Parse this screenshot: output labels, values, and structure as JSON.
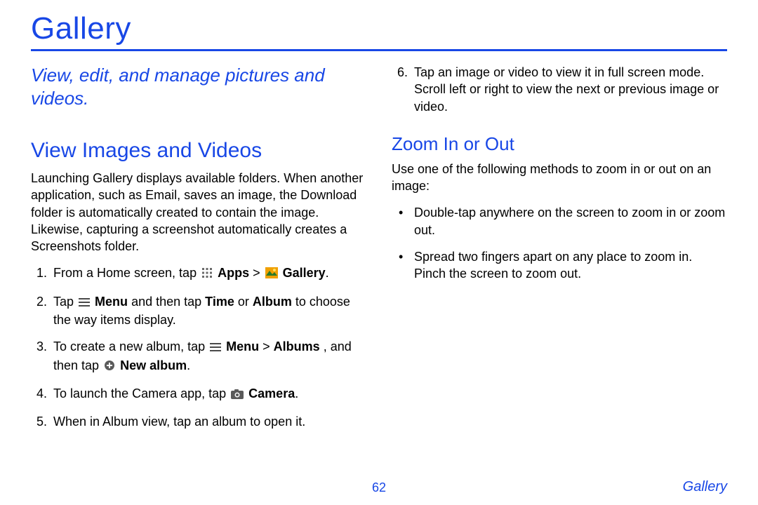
{
  "page_title": "Gallery",
  "subtitle": "View, edit, and manage pictures and videos.",
  "section_view": {
    "heading": "View Images and Videos",
    "intro": "Launching Gallery displays available folders. When another application, such as Email, saves an image, the Download folder is automatically created to contain the image. Likewise, capturing a screenshot automatically creates a Screenshots folder.",
    "steps": {
      "s1_a": "From a Home screen, tap ",
      "s1_apps": "Apps",
      "s1_gt": " > ",
      "s1_gallery": "Gallery",
      "s1_end": ".",
      "s2_a": "Tap ",
      "s2_menu": "Menu",
      "s2_b": " and then tap ",
      "s2_time": "Time",
      "s2_c": " or ",
      "s2_album": "Album",
      "s2_d": " to choose the way items display.",
      "s3_a": "To create a new album, tap ",
      "s3_menu": "Menu",
      "s3_gt": " > ",
      "s3_albums": "Albums",
      "s3_b": ", and then tap ",
      "s3_new": "New album",
      "s3_end": ".",
      "s4_a": "To launch the Camera app, tap ",
      "s4_camera": "Camera",
      "s4_end": ".",
      "s5": "When in Album view, tap an album to open it."
    }
  },
  "right_col": {
    "step6": "Tap an image or video to view it in full screen mode. Scroll left or right to view the next or previous image or video.",
    "zoom_heading": "Zoom In or Out",
    "zoom_intro": "Use one of the following methods to zoom in or out on an image:",
    "zoom_b1": "Double-tap anywhere on the screen to zoom in or zoom out.",
    "zoom_b2": "Spread two fingers apart on any place to zoom in. Pinch the screen to zoom out."
  },
  "footer": {
    "page_number": "62",
    "section": "Gallery"
  }
}
